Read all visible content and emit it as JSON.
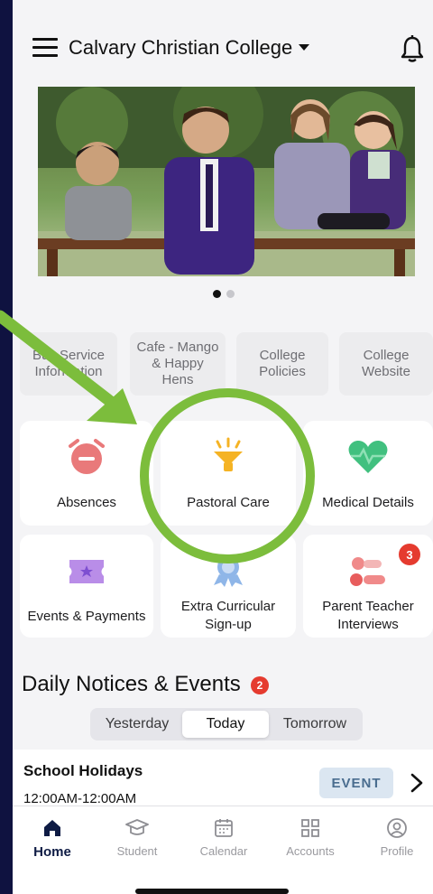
{
  "header": {
    "school_name": "Calvary Christian College"
  },
  "carousel": {
    "pages": 2,
    "active_page": 1
  },
  "quick_links": [
    {
      "label": "Bus Service Information"
    },
    {
      "label": "Cafe - Mango & Happy Hens"
    },
    {
      "label": "College Policies"
    },
    {
      "label": "College Website"
    }
  ],
  "tiles": {
    "absences": "Absences",
    "pastoral_care": "Pastoral Care",
    "medical_details": "Medical Details",
    "events_payments": "Events & Payments",
    "extra_curricular": "Extra Curricular Sign-up",
    "parent_teacher": "Parent Teacher Interviews",
    "parent_teacher_badge": "3"
  },
  "notices": {
    "title": "Daily Notices & Events",
    "badge": "2",
    "segments": [
      "Yesterday",
      "Today",
      "Tomorrow"
    ],
    "selected_segment": "Today",
    "event": {
      "title": "School Holidays",
      "time": "12:00AM-12:00AM",
      "tag": "EVENT"
    }
  },
  "tabbar": {
    "tabs": [
      {
        "label": "Home",
        "icon": "home-icon",
        "active": true
      },
      {
        "label": "Student",
        "icon": "graduation-cap-icon",
        "active": false
      },
      {
        "label": "Calendar",
        "icon": "calendar-icon",
        "active": false
      },
      {
        "label": "Accounts",
        "icon": "grid-icon",
        "active": false
      },
      {
        "label": "Profile",
        "icon": "user-circle-icon",
        "active": false
      }
    ]
  },
  "colors": {
    "annotation_green": "#7cbd3c",
    "active_tab": "#0e1b44",
    "badge_red": "#e53b2f",
    "event_tag_bg": "#dbe6f1"
  }
}
